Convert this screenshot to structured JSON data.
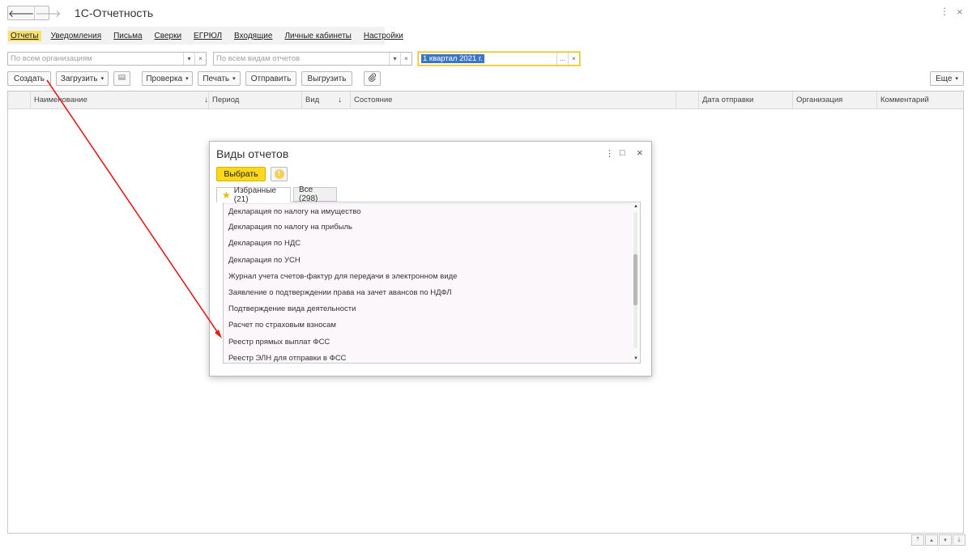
{
  "titlebar": {
    "back_icon": "arrow-left-icon",
    "forward_icon": "arrow-right-icon",
    "back_glyph": "🡐",
    "forward_glyph": "🡒",
    "app_title": "1С-Отчетность",
    "more_glyph": "⋮",
    "close_glyph": "×"
  },
  "nav_tabs": [
    {
      "label": "Отчеты",
      "active": true
    },
    {
      "label": "Уведомления"
    },
    {
      "label": "Письма"
    },
    {
      "label": "Сверки"
    },
    {
      "label": "ЕГРЮЛ"
    },
    {
      "label": "Входящие"
    },
    {
      "label": "Личные кабинеты"
    },
    {
      "label": "Настройки"
    }
  ],
  "filters": {
    "org_placeholder": "По всем организациям",
    "type_placeholder": "По всем видам отчетов",
    "period_value": "1 квартал 2021 г.",
    "dropdown_glyph": "▾",
    "clear_glyph": "×",
    "select_glyph": "..."
  },
  "toolbar": {
    "create_label": "Создать",
    "load_label": "Загрузить",
    "check_label": "Проверка",
    "print_label": "Печать",
    "send_label": "Отправить",
    "upload_label": "Выгрузить",
    "more_label": "Еще",
    "attach_icon": "paperclip-icon",
    "scan_icon": "scanner-icon",
    "arrow_glyph": "▾"
  },
  "table": {
    "columns": [
      "Наименование",
      "Период",
      "Вид",
      "Состояние",
      "Дата отправки",
      "Организация",
      "Комментарий"
    ],
    "sort_glyph": "↓"
  },
  "footer_nav": [
    "⤒",
    "▴",
    "▾",
    "⤓"
  ],
  "dialog": {
    "title": "Виды отчетов",
    "more_glyph": "⋮",
    "maximize_glyph": "□",
    "close_glyph": "×",
    "select_label": "Выбрать",
    "info_glyph": "!",
    "tabs": [
      {
        "label": "Избранные (21)",
        "active": true,
        "icon": "star-icon"
      },
      {
        "label": "Все (298)"
      }
    ],
    "star_glyph": "★",
    "items": [
      "Декларация по налогу на имущество",
      "Декларация по налогу на прибыль",
      "Декларация по НДС",
      "Декларация по УСН",
      "Журнал учета счетов-фактур для передачи в электронном виде",
      "Заявление о подтверждении права на зачет авансов по НДФЛ",
      "Подтверждение вида деятельности",
      "Расчет по страховым взносам",
      "Реестр прямых выплат ФСС",
      "Реестр ЭЛН для отправки в ФСС"
    ],
    "scroll_up_glyph": "▲",
    "scroll_down_glyph": "▼"
  },
  "colors": {
    "accent_yellow": "#fbd71e",
    "active_tab": "#f7e16c",
    "selection_blue": "#3c75c2",
    "annotation_red": "#e21d1d"
  }
}
